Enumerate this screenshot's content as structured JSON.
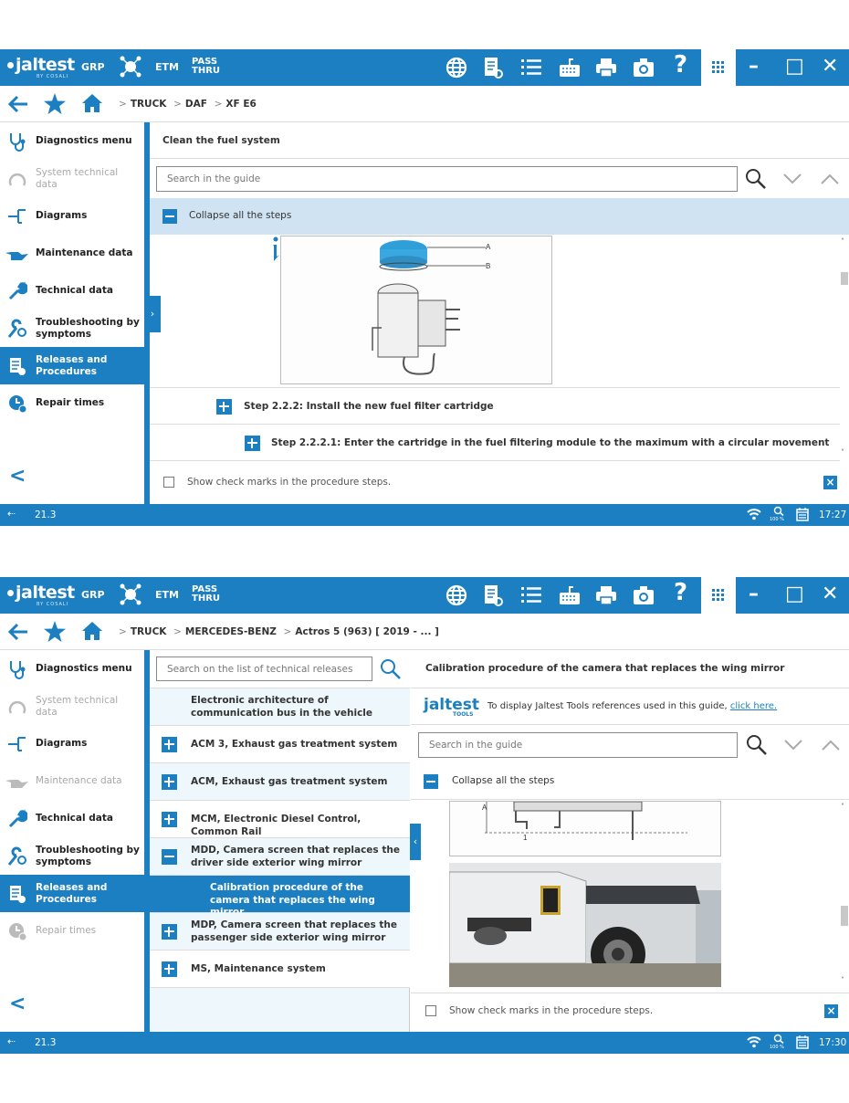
{
  "app": {
    "logo_text": "jaltest",
    "logo_sub": "BY COSALI",
    "menu_grp": "GRP",
    "menu_etm": "ETM",
    "menu_pass_1": "PASS",
    "menu_pass_2": "THRU",
    "help_label": "?",
    "minimize": "–",
    "maximize": "□",
    "close": "✕",
    "colors": {
      "brand": "#1b7fc1",
      "active_row": "#cfe3f3",
      "alt_row": "#eef7fc"
    }
  },
  "screen1": {
    "breadcrumb": [
      "TRUCK",
      "DAF",
      "XF E6"
    ],
    "sidebar": {
      "items": [
        {
          "label": "Diagnostics menu",
          "icon": "stethoscope-icon",
          "state": "normal"
        },
        {
          "label": "System technical data",
          "icon": "system-icon",
          "state": "disabled"
        },
        {
          "label": "Diagrams",
          "icon": "diagram-icon",
          "state": "normal"
        },
        {
          "label": "Maintenance data",
          "icon": "oil-can-icon",
          "state": "normal"
        },
        {
          "label": "Technical data",
          "icon": "wrench-icon",
          "state": "normal"
        },
        {
          "label": "Troubleshooting by symptoms",
          "icon": "troubleshooting-icon",
          "state": "normal"
        },
        {
          "label": "Releases and Procedures",
          "icon": "procedures-icon",
          "state": "active"
        },
        {
          "label": "Repair times",
          "icon": "repair-times-icon",
          "state": "normal"
        }
      ]
    },
    "guide_title": "Clean the fuel system",
    "search_placeholder": "Search in the guide",
    "collapse_label": "Collapse all the steps",
    "figure_labels": {
      "a": "A",
      "b": "B"
    },
    "steps": [
      {
        "label": "Step 2.2.2: Install the new fuel filter cartridge"
      },
      {
        "label": "Step 2.2.2.1: Enter the cartridge in the fuel filtering module to the maximum with a circular movement"
      }
    ],
    "check_label": "Show check marks in the procedure steps.",
    "status": {
      "version": "21.3",
      "zoom": "100 %",
      "time": "17:27"
    }
  },
  "screen2": {
    "breadcrumb": [
      "TRUCK",
      "MERCEDES-BENZ",
      "Actros 5 (963) [ 2019 - ... ]"
    ],
    "sidebar": {
      "items": [
        {
          "label": "Diagnostics menu",
          "icon": "stethoscope-icon",
          "state": "normal"
        },
        {
          "label": "System technical data",
          "icon": "system-icon",
          "state": "disabled"
        },
        {
          "label": "Diagrams",
          "icon": "diagram-icon",
          "state": "normal"
        },
        {
          "label": "Maintenance data",
          "icon": "oil-can-icon",
          "state": "disabled"
        },
        {
          "label": "Technical data",
          "icon": "wrench-icon",
          "state": "normal"
        },
        {
          "label": "Troubleshooting by symptoms",
          "icon": "troubleshooting-icon",
          "state": "normal"
        },
        {
          "label": "Releases and Procedures",
          "icon": "procedures-icon",
          "state": "active"
        },
        {
          "label": "Repair times",
          "icon": "repair-times-icon",
          "state": "disabled"
        }
      ]
    },
    "list_search_placeholder": "Search on the list of technical releases",
    "releases": [
      {
        "label": "Electronic architecture of communication bus in the vehicle",
        "control": "none"
      },
      {
        "label": "ACM 3, Exhaust gas treatment system",
        "control": "plus"
      },
      {
        "label": "ACM, Exhaust gas treatment system",
        "control": "plus"
      },
      {
        "label": "MCM, Electronic Diesel Control, Common Rail",
        "control": "plus"
      },
      {
        "label": "MDD, Camera screen that replaces the driver side exterior wing mirror",
        "control": "minus"
      },
      {
        "label": "Calibration procedure of the camera that replaces the wing mirror",
        "control": "selected"
      },
      {
        "label": "MDP, Camera screen that replaces the passenger side exterior wing mirror",
        "control": "plus"
      },
      {
        "label": "MS, Maintenance system",
        "control": "plus"
      }
    ],
    "guide_title": "Calibration procedure of the camera that replaces the wing mirror",
    "tools": {
      "logo": "jaltest",
      "logo_sub": "TOOLS",
      "text": "To display Jaltest Tools references used in this guide,",
      "link": "click here."
    },
    "search_placeholder": "Search in the guide",
    "collapse_label": "Collapse all the steps",
    "figure_labels": {
      "a": "A",
      "one": "1"
    },
    "check_label": "Show check marks in the procedure steps.",
    "status": {
      "version": "21.3",
      "zoom": "100 %",
      "time": "17:30"
    }
  }
}
